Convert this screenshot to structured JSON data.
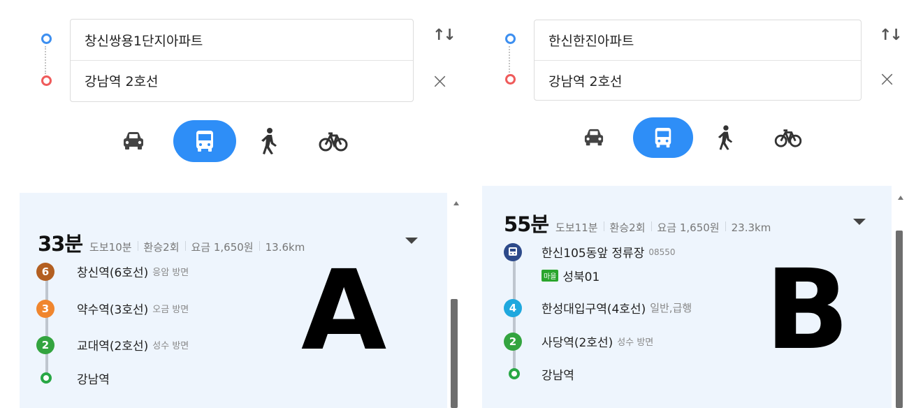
{
  "panels": [
    {
      "id": "A",
      "origin": "창신쌍용1단지아파트",
      "destination": "강남역 2호선",
      "summary": {
        "time": "33분",
        "walk": "도보10분",
        "transfer": "환승2회",
        "fare": "요금 1,650원",
        "distance": "13.6km"
      },
      "steps": [
        {
          "badge": "6",
          "badge_color": "#b35f21",
          "name": "창신역(6호선)",
          "dir": "응암 방면"
        },
        {
          "badge": "3",
          "badge_color": "#f0862e",
          "name": "약수역(3호선)",
          "dir": "오금 방면"
        },
        {
          "badge": "2",
          "badge_color": "#33a43f",
          "name": "교대역(2호선)",
          "dir": "성수 방면"
        },
        {
          "badge": "",
          "badge_color": "#28a745",
          "name": "강남역",
          "dir": ""
        }
      ],
      "overlay_label": "A"
    },
    {
      "id": "B",
      "origin": "한신한진아파트",
      "destination": "강남역 2호선",
      "summary": {
        "time": "55분",
        "walk": "도보11분",
        "transfer": "환승2회",
        "fare": "요금 1,650원",
        "distance": "23.3km"
      },
      "steps": [
        {
          "badge": "bus",
          "badge_color": "#2d4a8a",
          "name": "한신105동앞 정류장",
          "dir": "08550",
          "bus_tag": "마을",
          "bus_route": "성북01"
        },
        {
          "badge": "4",
          "badge_color": "#1fa8de",
          "name": "한성대입구역(4호선)",
          "dir": "일반,급행"
        },
        {
          "badge": "2",
          "badge_color": "#33a43f",
          "name": "사당역(2호선)",
          "dir": "성수 방면"
        },
        {
          "badge": "",
          "badge_color": "#28a745",
          "name": "강남역",
          "dir": ""
        }
      ],
      "overlay_label": "B"
    }
  ],
  "modes": [
    {
      "name": "car",
      "icon": "car-icon",
      "active": false
    },
    {
      "name": "transit",
      "icon": "bus-icon",
      "active": true
    },
    {
      "name": "walk",
      "icon": "walk-icon",
      "active": false
    },
    {
      "name": "bike",
      "icon": "bike-icon",
      "active": false
    }
  ],
  "icons": {
    "swap": "swap-icon",
    "close": "close-icon",
    "expand": "caret-down-icon"
  },
  "colors": {
    "accent": "#2e8ef7",
    "start": "#3d8ff0",
    "end": "#ef5b5b",
    "result_bg": "#eef5fd"
  }
}
